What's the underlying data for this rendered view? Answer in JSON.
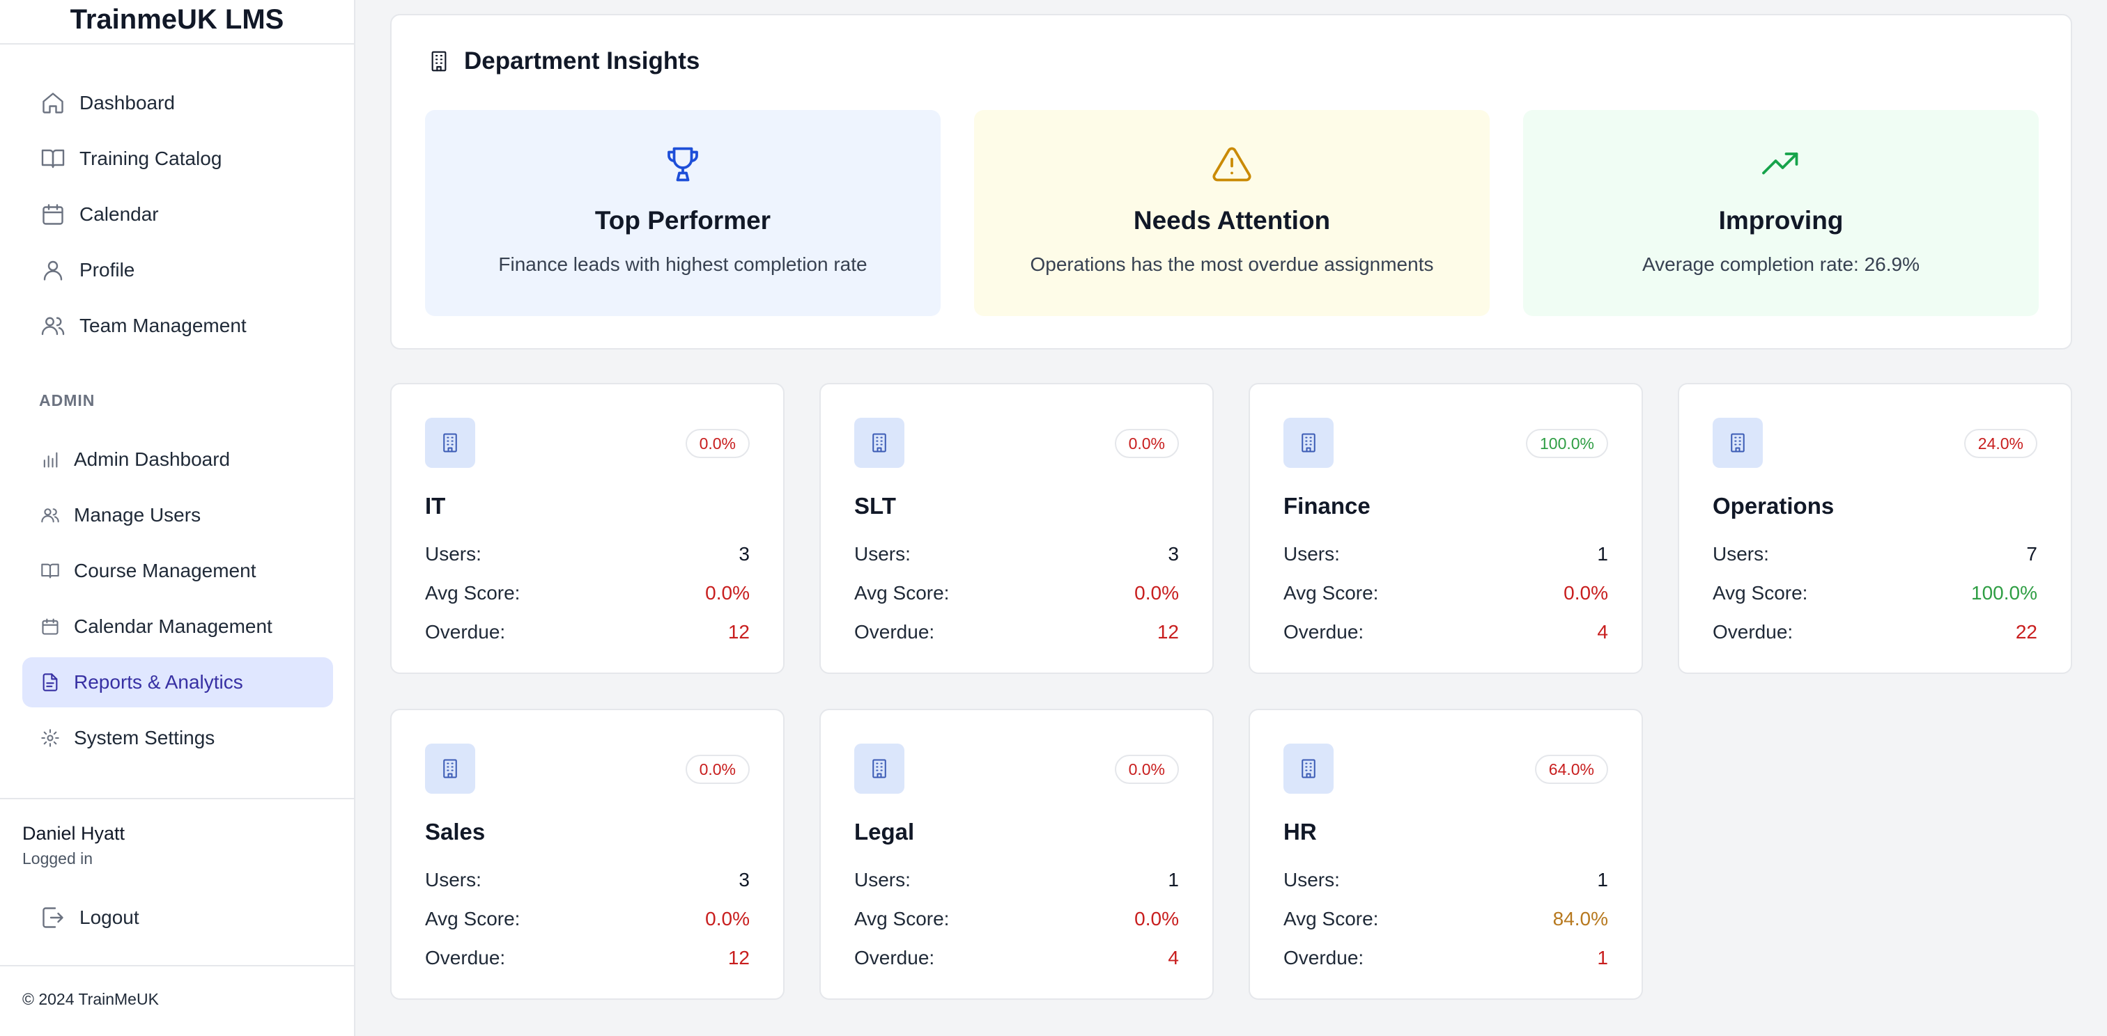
{
  "app": {
    "title": "TrainmeUK LMS"
  },
  "sidebar": {
    "nav": [
      {
        "label": "Dashboard",
        "icon": "home-icon"
      },
      {
        "label": "Training Catalog",
        "icon": "book-icon"
      },
      {
        "label": "Calendar",
        "icon": "calendar-icon"
      },
      {
        "label": "Profile",
        "icon": "user-icon"
      },
      {
        "label": "Team Management",
        "icon": "users-icon"
      }
    ],
    "admin_heading": "ADMIN",
    "admin": [
      {
        "label": "Admin Dashboard",
        "icon": "bar-chart-icon"
      },
      {
        "label": "Manage Users",
        "icon": "users-icon"
      },
      {
        "label": "Course Management",
        "icon": "book-icon"
      },
      {
        "label": "Calendar Management",
        "icon": "calendar-icon"
      },
      {
        "label": "Reports & Analytics",
        "icon": "file-text-icon",
        "active": true
      },
      {
        "label": "System Settings",
        "icon": "gear-icon"
      }
    ],
    "user": {
      "name": "Daniel Hyatt",
      "status": "Logged in"
    },
    "logout_label": "Logout",
    "copyright": "© 2024 TrainMeUK"
  },
  "insights": {
    "title": "Department Insights",
    "cards": [
      {
        "heading": "Top Performer",
        "text": "Finance leads with highest completion rate",
        "icon": "trophy-icon",
        "color": "#1d4ed8"
      },
      {
        "heading": "Needs Attention",
        "text": "Operations has the most overdue assignments",
        "icon": "warning-icon",
        "color": "#ca8a04"
      },
      {
        "heading": "Improving",
        "text": "Average completion rate: 26.9%",
        "icon": "trending-up-icon",
        "color": "#16a34a"
      }
    ]
  },
  "labels": {
    "users": "Users:",
    "avg_score": "Avg Score:",
    "overdue": "Overdue:"
  },
  "departments": [
    {
      "name": "IT",
      "badge": "0.0%",
      "users": "3",
      "avg_score": "0.0%",
      "overdue": "12"
    },
    {
      "name": "SLT",
      "badge": "0.0%",
      "users": "3",
      "avg_score": "0.0%",
      "overdue": "12"
    },
    {
      "name": "Finance",
      "badge": "100.0%",
      "users": "1",
      "avg_score": "0.0%",
      "overdue": "4"
    },
    {
      "name": "Operations",
      "badge": "24.0%",
      "users": "7",
      "avg_score": "100.0%",
      "overdue": "22"
    },
    {
      "name": "Sales",
      "badge": "0.0%",
      "users": "3",
      "avg_score": "0.0%",
      "overdue": "12"
    },
    {
      "name": "Legal",
      "badge": "0.0%",
      "users": "1",
      "avg_score": "0.0%",
      "overdue": "4"
    },
    {
      "name": "HR",
      "badge": "64.0%",
      "users": "1",
      "avg_score": "84.0%",
      "overdue": "1"
    }
  ],
  "colors": {
    "active_bg": "#e0e7ff",
    "active_text": "#3730a3",
    "danger": "#c81e1e",
    "success": "#2f9e44",
    "warning": "#b7791f"
  }
}
